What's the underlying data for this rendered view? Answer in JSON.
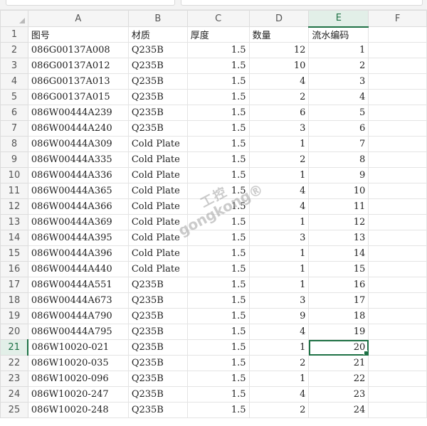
{
  "columns": [
    "A",
    "B",
    "C",
    "D",
    "E",
    "F"
  ],
  "selected_cell": {
    "row": 21,
    "column": "E"
  },
  "rows": [
    {
      "n": "1",
      "A": "图号",
      "B": "材质",
      "C": "厚度",
      "D": "数量",
      "E": "流水编码"
    },
    {
      "n": "2",
      "A": "086G00137A008",
      "B": "Q235B",
      "C": "1.5",
      "D": "12",
      "E": "1"
    },
    {
      "n": "3",
      "A": "086G00137A012",
      "B": "Q235B",
      "C": "1.5",
      "D": "10",
      "E": "2"
    },
    {
      "n": "4",
      "A": "086G00137A013",
      "B": "Q235B",
      "C": "1.5",
      "D": "4",
      "E": "3"
    },
    {
      "n": "5",
      "A": "086G00137A015",
      "B": "Q235B",
      "C": "1.5",
      "D": "2",
      "E": "4"
    },
    {
      "n": "6",
      "A": "086W00444A239",
      "B": "Q235B",
      "C": "1.5",
      "D": "6",
      "E": "5"
    },
    {
      "n": "7",
      "A": "086W00444A240",
      "B": "Q235B",
      "C": "1.5",
      "D": "3",
      "E": "6"
    },
    {
      "n": "8",
      "A": "086W00444A309",
      "B": "Cold Plate",
      "C": "1.5",
      "D": "1",
      "E": "7"
    },
    {
      "n": "9",
      "A": "086W00444A335",
      "B": "Cold Plate",
      "C": "1.5",
      "D": "2",
      "E": "8"
    },
    {
      "n": "10",
      "A": "086W00444A336",
      "B": "Cold Plate",
      "C": "1.5",
      "D": "1",
      "E": "9"
    },
    {
      "n": "11",
      "A": "086W00444A365",
      "B": "Cold Plate",
      "C": "1.5",
      "D": "4",
      "E": "10"
    },
    {
      "n": "12",
      "A": "086W00444A366",
      "B": "Cold Plate",
      "C": "1.5",
      "D": "4",
      "E": "11"
    },
    {
      "n": "13",
      "A": "086W00444A369",
      "B": "Cold Plate",
      "C": "1.5",
      "D": "1",
      "E": "12"
    },
    {
      "n": "14",
      "A": "086W00444A395",
      "B": "Cold Plate",
      "C": "1.5",
      "D": "3",
      "E": "13"
    },
    {
      "n": "15",
      "A": "086W00444A396",
      "B": "Cold Plate",
      "C": "1.5",
      "D": "1",
      "E": "14"
    },
    {
      "n": "16",
      "A": "086W00444A440",
      "B": "Cold Plate",
      "C": "1.5",
      "D": "1",
      "E": "15"
    },
    {
      "n": "17",
      "A": "086W00444A551",
      "B": "Q235B",
      "C": "1.5",
      "D": "1",
      "E": "16"
    },
    {
      "n": "18",
      "A": "086W00444A673",
      "B": "Q235B",
      "C": "1.5",
      "D": "3",
      "E": "17"
    },
    {
      "n": "19",
      "A": "086W00444A790",
      "B": "Q235B",
      "C": "1.5",
      "D": "9",
      "E": "18"
    },
    {
      "n": "20",
      "A": "086W00444A795",
      "B": "Q235B",
      "C": "1.5",
      "D": "4",
      "E": "19"
    },
    {
      "n": "21",
      "A": "086W10020-021",
      "B": "Q235B",
      "C": "1.5",
      "D": "1",
      "E": "20"
    },
    {
      "n": "22",
      "A": "086W10020-035",
      "B": "Q235B",
      "C": "1.5",
      "D": "2",
      "E": "21"
    },
    {
      "n": "23",
      "A": "086W10020-096",
      "B": "Q235B",
      "C": "1.5",
      "D": "1",
      "E": "22"
    },
    {
      "n": "24",
      "A": "086W10020-247",
      "B": "Q235B",
      "C": "1.5",
      "D": "4",
      "E": "23"
    },
    {
      "n": "25",
      "A": "086W10020-248",
      "B": "Q235B",
      "C": "1.5",
      "D": "2",
      "E": "24"
    }
  ],
  "watermark": {
    "line1": "工控",
    "line2": "gongkong®"
  },
  "colors": {
    "selection": "#1e7145",
    "header_bg": "#f5f5f5",
    "gridline": "#e4e4e4"
  }
}
